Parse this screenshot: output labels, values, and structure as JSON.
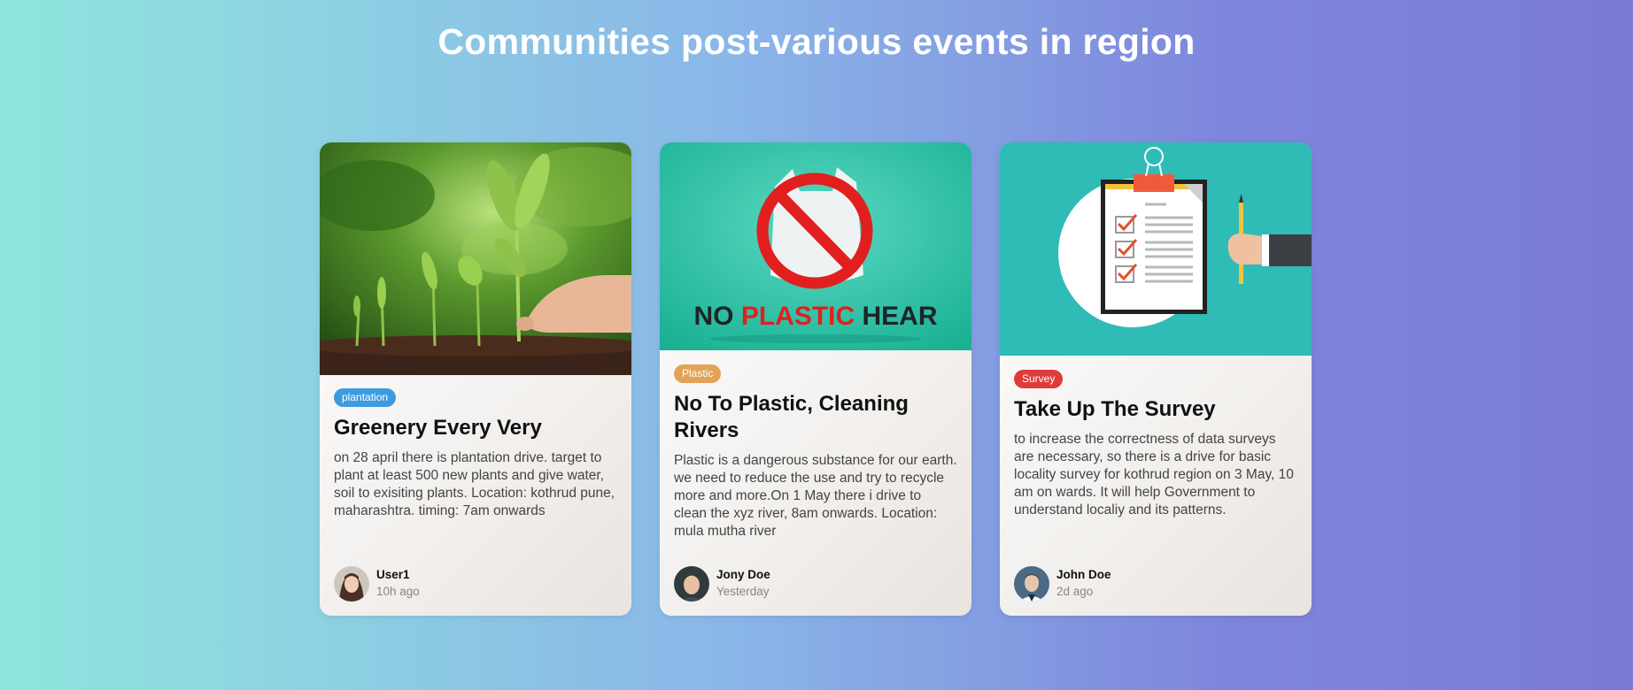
{
  "page": {
    "title": "Communities post-various events in region"
  },
  "cards": [
    {
      "tag": "plantation",
      "tag_color": "#3d9be0",
      "title": "Greenery Every Very",
      "description": "on 28 april there is plantation drive. target to plant at least 500 new plants and give water, soil to exisiting plants. Location: kothrud pune, maharashtra. timing: 7am onwards",
      "author": "User1",
      "time": "10h ago"
    },
    {
      "tag": "Plastic",
      "tag_color": "#e2a25a",
      "title": "No To Plastic, Cleaning Rivers",
      "description": "Plastic is a dangerous substance for our earth. we need to reduce the use and try to recycle more and more.On 1 May there i drive to clean the xyz river, 8am onwards. Location: mula mutha river",
      "author": "Jony Doe",
      "time": "Yesterday",
      "image_text": {
        "a": "NO",
        "b": "PLASTIC",
        "c": "HEAR"
      }
    },
    {
      "tag": "Survey",
      "tag_color": "#de3b3b",
      "title": "Take Up The Survey",
      "description": "to increase the correctness of data surveys are necessary, so there is a drive for basic locality survey for kothrud region on 3 May, 10 am on wards. It will help Government to understand localiy and its patterns.",
      "author": "John Doe",
      "time": "2d ago"
    }
  ]
}
